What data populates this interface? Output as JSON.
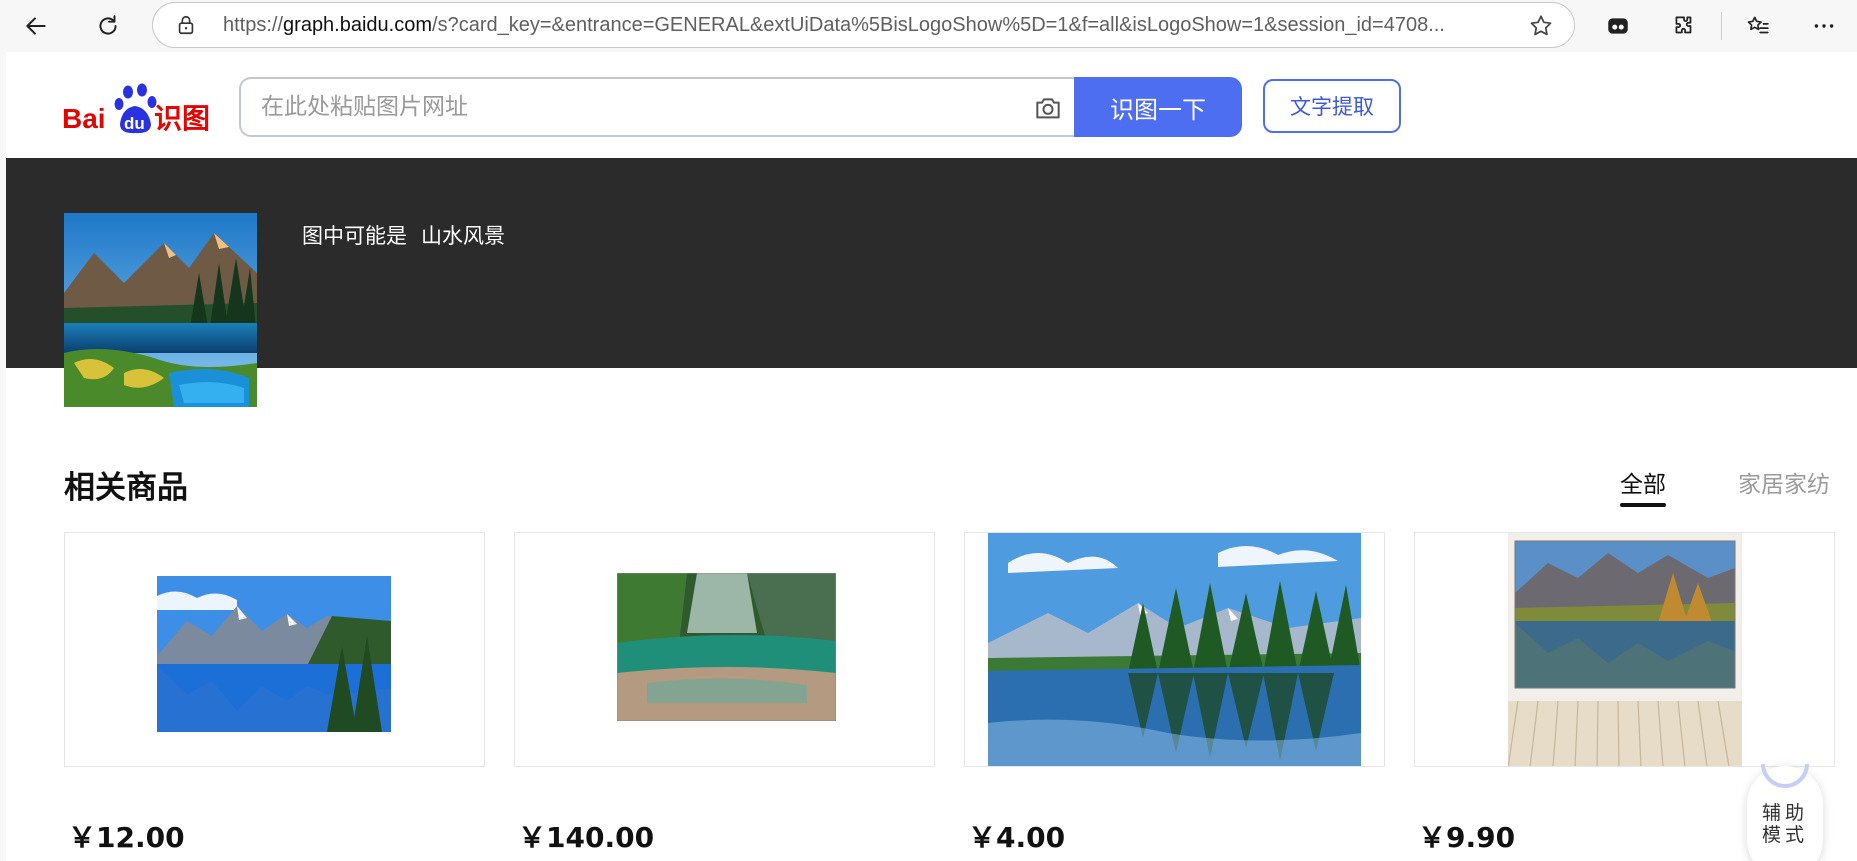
{
  "browser": {
    "url_prefix": "https://",
    "url_host": "graph.baidu.com",
    "url_rest": "/s?card_key=&entrance=GENERAL&extUiData%5BisLogoShow%5D=1&f=all&isLogoShow=1&session_id=4708..."
  },
  "header": {
    "logo_text_bai": "Bai",
    "logo_text_du": "du",
    "logo_text_shitu": "识图",
    "search_placeholder": "在此处粘贴图片网址",
    "search_button": "识图一下",
    "ocr_button": "文字提取"
  },
  "result": {
    "guess_prefix": "图中可能是",
    "guess_value": "山水风景"
  },
  "products": {
    "title": "相关商品",
    "tabs": [
      "全部",
      "家居家纺"
    ],
    "items": [
      {
        "price": "￥12.00"
      },
      {
        "price": "￥140.00"
      },
      {
        "price": "￥4.00"
      },
      {
        "price": "￥9.90"
      }
    ]
  },
  "assist": {
    "label": "辅助模式"
  },
  "colors": {
    "brand_blue": "#4e6ef2",
    "banner_bg": "#2b2b2c",
    "logo_red": "#e10602",
    "logo_blue": "#2932e1"
  },
  "icons": {
    "back": "arrow-left-icon",
    "refresh": "refresh-icon",
    "lock": "lock-icon",
    "favorite": "star-icon",
    "camera": "camera-icon"
  }
}
